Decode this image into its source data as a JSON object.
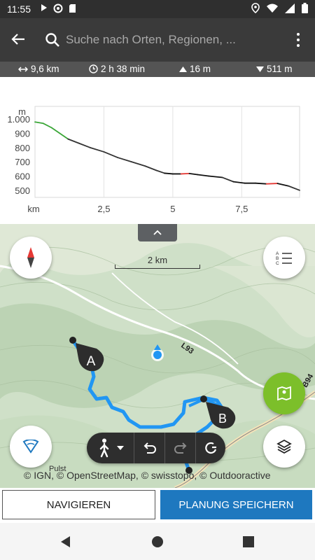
{
  "status_bar": {
    "time": "11:55"
  },
  "search": {
    "placeholder": "Suche nach Orten, Regionen, ..."
  },
  "stats": {
    "distance": "9,6 km",
    "duration": "2 h 38 min",
    "ascent": "16 m",
    "descent": "511 m"
  },
  "chart_data": {
    "type": "line",
    "ylabel": "m",
    "xlabel": "km",
    "y_ticks": [
      "1.000",
      "900",
      "800",
      "700",
      "600",
      "500"
    ],
    "y_values": [
      1000,
      900,
      800,
      700,
      600,
      500
    ],
    "x_ticks": [
      "km",
      "2,5",
      "5",
      "7,5"
    ],
    "x_values": [
      0,
      2.5,
      5,
      7.5
    ],
    "xlim": [
      0,
      9.6
    ],
    "ylim": [
      450,
      1050
    ],
    "grid": true,
    "series": [
      {
        "x": [
          0,
          0.3,
          0.6,
          0.9,
          1.2,
          1.6,
          2.0,
          2.5,
          3.0,
          3.5,
          4.0,
          4.4,
          4.7,
          5.0,
          5.3,
          5.6,
          5.9,
          6.3,
          6.8,
          7.2,
          7.6,
          8.0,
          8.4,
          8.8,
          9.2,
          9.6
        ],
        "y": [
          980,
          970,
          940,
          900,
          860,
          830,
          800,
          770,
          730,
          700,
          670,
          640,
          620,
          615,
          615,
          618,
          610,
          600,
          590,
          560,
          550,
          550,
          545,
          548,
          530,
          500
        ]
      }
    ]
  },
  "map": {
    "scale_label": "2 km",
    "marker_a": "A",
    "marker_b": "B",
    "road_1": "L93",
    "road_2": "B94",
    "place": "Pulst",
    "attribution": "© IGN, © OpenStreetMap, © swisstopo, © Outdooractive"
  },
  "buttons": {
    "navigate": "NAVIGIEREN",
    "save_plan": "PLANUNG SPEICHERN"
  },
  "colors": {
    "route": "#2196f3",
    "save": "#1e78bf",
    "green_fab": "#7cbf2a"
  }
}
